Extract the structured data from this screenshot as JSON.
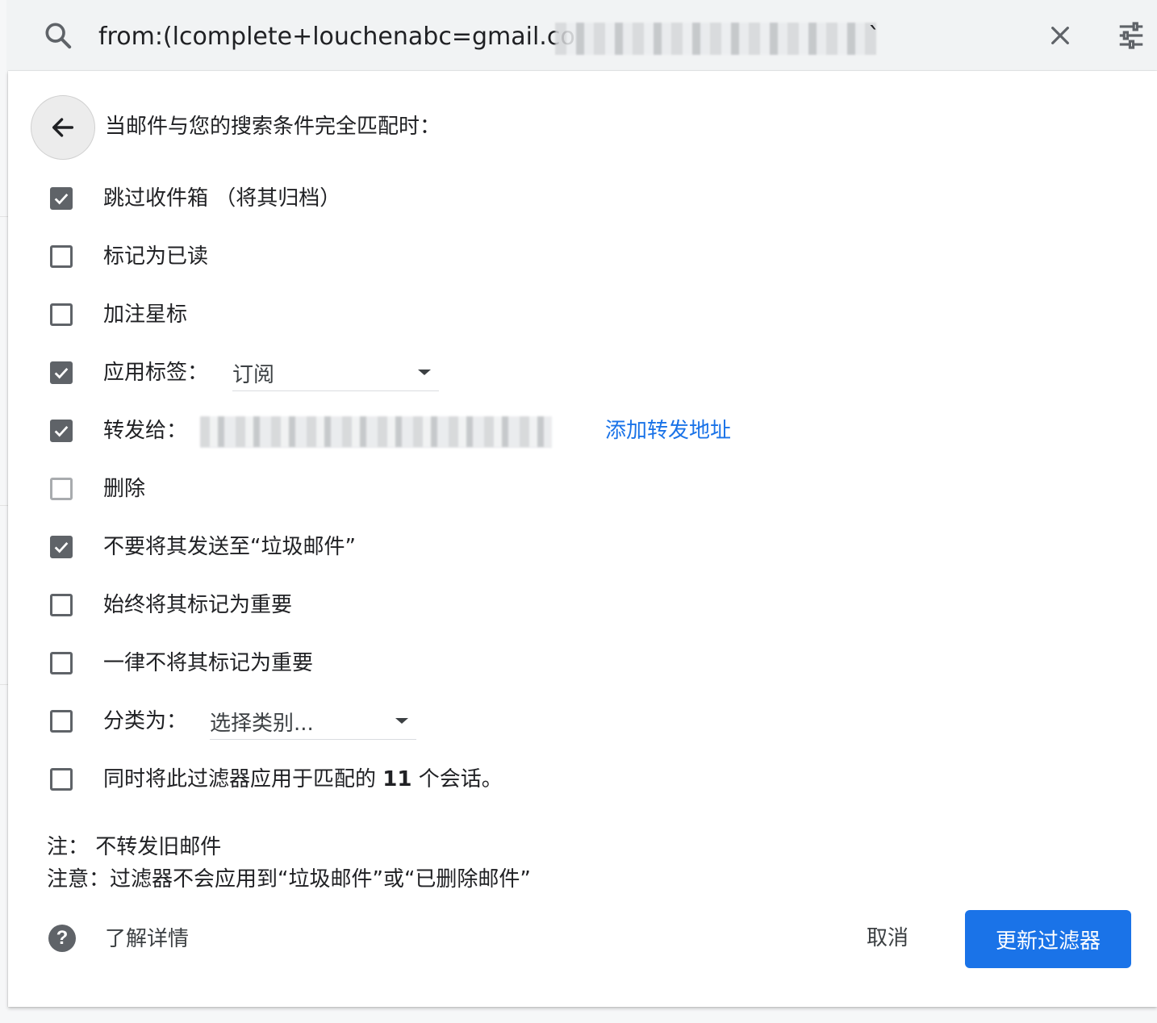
{
  "search": {
    "query_visible": "from:(lcomplete+louchenabc=gmail.co",
    "query_tail": "`"
  },
  "panel": {
    "header": "当邮件与您的搜索条件完全匹配时：",
    "options": [
      {
        "label": "跳过收件箱 （将其归档）",
        "checked": true
      },
      {
        "label": "标记为已读",
        "checked": false
      },
      {
        "label": "加注星标",
        "checked": false
      },
      {
        "label": "应用标签：",
        "checked": true,
        "select_value": "订阅"
      },
      {
        "label": "转发给：",
        "checked": true,
        "link": "添加转发地址"
      },
      {
        "label": "删除",
        "checked": false
      },
      {
        "label": "不要将其发送至“垃圾邮件”",
        "checked": true
      },
      {
        "label": "始终将其标记为重要",
        "checked": false
      },
      {
        "label": "一律不将其标记为重要",
        "checked": false
      },
      {
        "label": "分类为：",
        "checked": false,
        "select_value": "选择类别..."
      },
      {
        "label_prefix": "同时将此过滤器应用于匹配的",
        "count": "11",
        "label_suffix": "个会话。",
        "checked": false
      }
    ],
    "note1": "注：  不转发旧邮件",
    "note2": "注意：过滤器不会应用到“垃圾邮件”或“已删除邮件”",
    "learn_more": "了解详情",
    "cancel": "取消",
    "submit": "更新过滤器"
  },
  "colors": {
    "primary": "#1a73e8",
    "checkbox": "#5f6368",
    "searchbar_bg": "#f1f3f4"
  },
  "icons": [
    "search-icon",
    "close-icon",
    "tune-icon",
    "arrow-back-icon",
    "check-icon",
    "caret-down-icon",
    "help-icon"
  ]
}
